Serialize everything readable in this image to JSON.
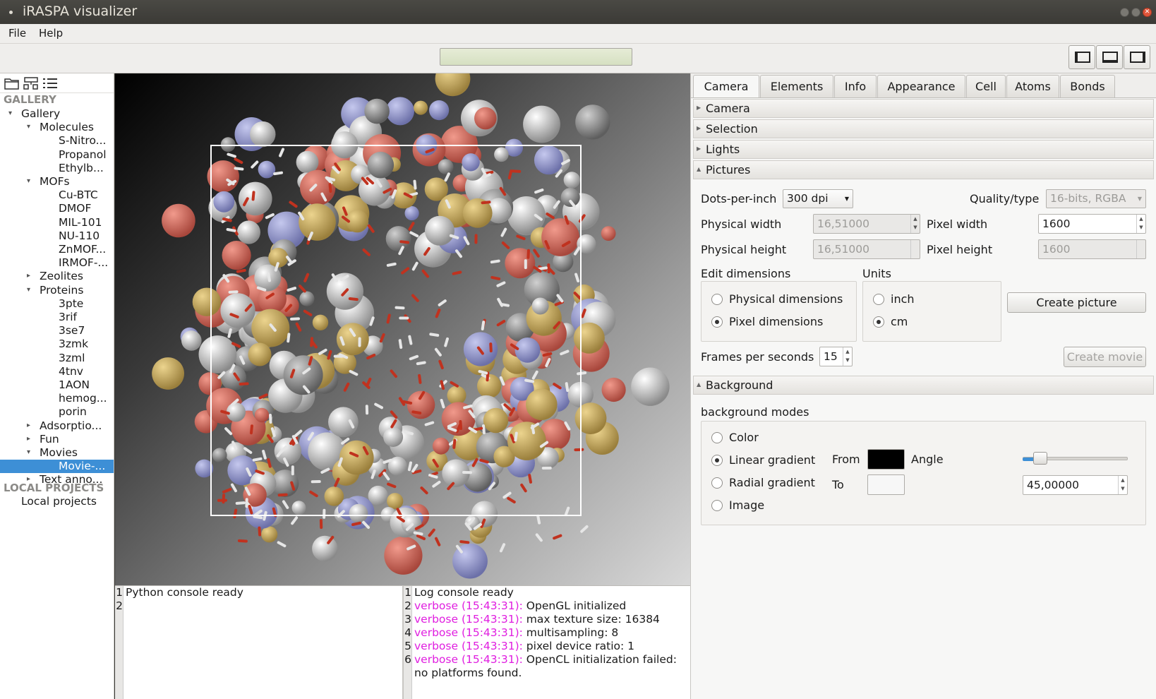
{
  "window": {
    "title": "iRASPA visualizer"
  },
  "menu": {
    "file": "File",
    "help": "Help"
  },
  "sidebar": {
    "section_gallery": "GALLERY",
    "section_local": "LOCAL PROJECTS",
    "tree": [
      {
        "label": "Gallery",
        "depth": 1,
        "arrow": "▾"
      },
      {
        "label": "Molecules",
        "depth": 2,
        "arrow": "▾"
      },
      {
        "label": "S-Nitro...",
        "depth": 3
      },
      {
        "label": "Propanol",
        "depth": 3
      },
      {
        "label": "Ethylb...",
        "depth": 3
      },
      {
        "label": "MOFs",
        "depth": 2,
        "arrow": "▾"
      },
      {
        "label": "Cu-BTC",
        "depth": 3
      },
      {
        "label": "DMOF",
        "depth": 3
      },
      {
        "label": "MIL-101",
        "depth": 3
      },
      {
        "label": "NU-110",
        "depth": 3
      },
      {
        "label": "ZnMOF...",
        "depth": 3
      },
      {
        "label": "IRMOF-...",
        "depth": 3
      },
      {
        "label": "Zeolites",
        "depth": 2,
        "arrow": "▸"
      },
      {
        "label": "Proteins",
        "depth": 2,
        "arrow": "▾"
      },
      {
        "label": "3pte",
        "depth": 3
      },
      {
        "label": "3rif",
        "depth": 3
      },
      {
        "label": "3se7",
        "depth": 3
      },
      {
        "label": "3zmk",
        "depth": 3
      },
      {
        "label": "3zml",
        "depth": 3
      },
      {
        "label": "4tnv",
        "depth": 3
      },
      {
        "label": "1AON",
        "depth": 3
      },
      {
        "label": "hemog...",
        "depth": 3
      },
      {
        "label": "porin",
        "depth": 3
      },
      {
        "label": "Adsorptio...",
        "depth": 2,
        "arrow": "▸"
      },
      {
        "label": "Fun",
        "depth": 2,
        "arrow": "▸"
      },
      {
        "label": "Movies",
        "depth": 2,
        "arrow": "▾"
      },
      {
        "label": "Movie-...",
        "depth": 3,
        "selected": true
      },
      {
        "label": "Text anno...",
        "depth": 2,
        "arrow": "▸"
      }
    ],
    "local_item": "Local projects"
  },
  "python_console": {
    "lines": [
      {
        "n": "1",
        "text": "Python console ready"
      },
      {
        "n": "2",
        "text": ""
      }
    ]
  },
  "log_console": {
    "header": {
      "n": "1",
      "text": "Log console ready"
    },
    "lines": [
      {
        "n": "2",
        "prefix": "verbose (15:43:31):",
        "text": " OpenGL initialized"
      },
      {
        "n": "3",
        "prefix": "verbose (15:43:31):",
        "text": " max texture size: 16384"
      },
      {
        "n": "4",
        "prefix": "verbose (15:43:31):",
        "text": " multisampling: 8"
      },
      {
        "n": "5",
        "prefix": "verbose (15:43:31):",
        "text": " pixel device ratio: 1"
      },
      {
        "n": "6",
        "prefix": "verbose (15:43:31):",
        "text": " OpenCL initialization failed:"
      }
    ],
    "continuation": "no platforms found."
  },
  "tabs": [
    "Camera",
    "Elements",
    "Info",
    "Appearance",
    "Cell",
    "Atoms",
    "Bonds"
  ],
  "sections": {
    "camera": "Camera",
    "selection": "Selection",
    "lights": "Lights",
    "pictures": "Pictures",
    "background": "Background"
  },
  "pictures": {
    "dpi_label": "Dots-per-inch",
    "dpi_value": "300 dpi",
    "quality_label": "Quality/type",
    "quality_value": "16-bits, RGBA",
    "phys_width_label": "Physical width",
    "phys_width_value": "16,51000",
    "pixel_width_label": "Pixel width",
    "pixel_width_value": "1600",
    "phys_height_label": "Physical height",
    "phys_height_value": "16,51000",
    "pixel_height_label": "Pixel height",
    "pixel_height_value": "1600",
    "edit_dims_label": "Edit dimensions",
    "opt_physical": "Physical dimensions",
    "opt_pixel": "Pixel dimensions",
    "units_label": "Units",
    "opt_inch": "inch",
    "opt_cm": "cm",
    "create_picture": "Create picture",
    "fps_label": "Frames per seconds",
    "fps_value": "15",
    "create_movie": "Create movie"
  },
  "background": {
    "modes_label": "background modes",
    "opt_color": "Color",
    "opt_linear": "Linear gradient",
    "opt_radial": "Radial gradient",
    "opt_image": "Image",
    "from_label": "From",
    "to_label": "To",
    "angle_label": "Angle",
    "angle_value": "45,00000",
    "angle_slider_fraction": 0.125,
    "from_color": "#000000",
    "to_color": "#f7f7f7"
  },
  "colors": {
    "accent": "#3d8fd6",
    "verbose": "#e01ee0"
  }
}
